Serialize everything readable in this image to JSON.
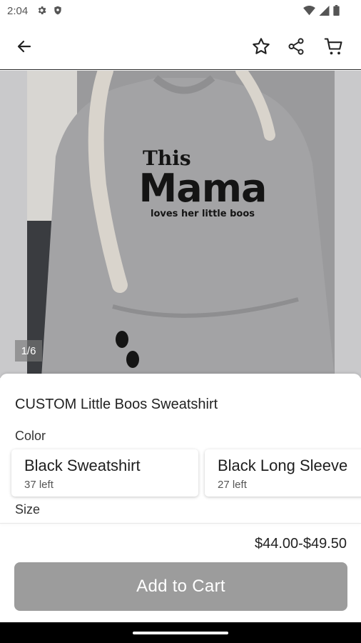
{
  "status_bar": {
    "time": "2:04",
    "left_icons": [
      "gear-icon",
      "shield-icon"
    ],
    "right_icons": [
      "wifi-icon",
      "signal-icon",
      "battery-icon"
    ]
  },
  "app_bar": {
    "icons": [
      "arrow-back-icon",
      "star-outline-icon",
      "share-icon",
      "cart-icon"
    ]
  },
  "gallery": {
    "page_indicator": "1/6",
    "print_text": {
      "line1": "This",
      "line2": "Mama",
      "line3": "loves her little boos"
    }
  },
  "product": {
    "title": "CUSTOM Little Boos Sweatshirt",
    "color_label": "Color",
    "variants": [
      {
        "name": "Black Sweatshirt",
        "stock": "37 left"
      },
      {
        "name": "Black Long Sleeve",
        "stock": "27 left"
      }
    ],
    "size_label": "Size",
    "price": "$44.00-$49.50",
    "add_to_cart_label": "Add to Cart"
  },
  "colors": {
    "button_disabled": "#9c9c9c",
    "sweatshirt_gray": "#9a9a9c",
    "text_primary": "#222222"
  }
}
